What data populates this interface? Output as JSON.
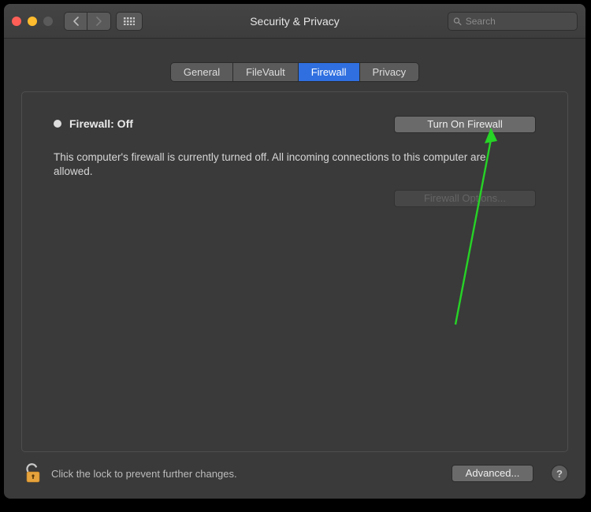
{
  "window": {
    "title": "Security & Privacy"
  },
  "search": {
    "placeholder": "Search"
  },
  "tabs": {
    "general": "General",
    "filevault": "FileVault",
    "firewall": "Firewall",
    "privacy": "Privacy"
  },
  "firewall": {
    "status_label": "Firewall: Off",
    "turn_on_label": "Turn On Firewall",
    "description": "This computer's firewall is currently turned off. All incoming connections to this computer are allowed.",
    "options_label": "Firewall Options..."
  },
  "footer": {
    "lock_hint": "Click the lock to prevent further changes.",
    "advanced_label": "Advanced...",
    "help_label": "?"
  }
}
